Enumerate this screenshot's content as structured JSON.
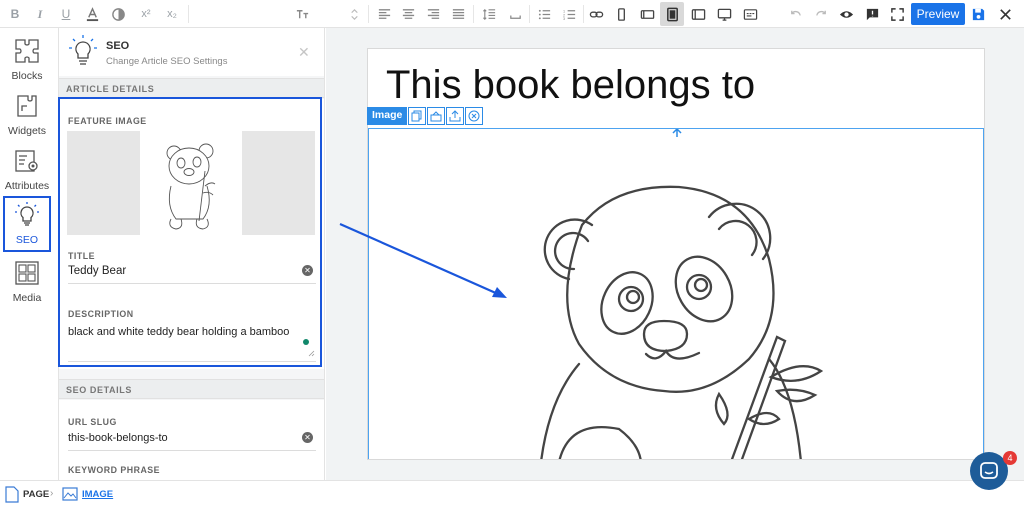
{
  "toolbar": {
    "buttons": [
      "bold-icon",
      "italic-icon",
      "underline-icon",
      "text-color-icon",
      "contrast-icon",
      "superscript-icon",
      "subscript-icon",
      "font-size-icon",
      "align-left-icon",
      "align-center-icon",
      "align-right-icon",
      "justify-icon",
      "line-height-icon",
      "space-icon",
      "list-icon",
      "numbered-list-icon",
      "link-icon",
      "mobile-icon",
      "tablet-landscape-icon",
      "tablet-icon",
      "tablet-wide-icon",
      "desktop-icon",
      "embed-icon",
      "undo-icon",
      "redo-icon",
      "eye-icon",
      "comment-icon",
      "fullscreen-icon",
      "save-icon"
    ],
    "superscript_label": "x²",
    "subscript_label": "x₂",
    "bold_label": "B",
    "italic_label": "I",
    "underline_label": "U",
    "preview_label": "Preview"
  },
  "rail": {
    "items": [
      {
        "label": "Blocks",
        "icon": "puzzle-icon"
      },
      {
        "label": "Widgets",
        "icon": "widget-icon"
      },
      {
        "label": "Attributes",
        "icon": "attributes-gear-icon"
      },
      {
        "label": "SEO",
        "icon": "lightbulb-icon",
        "active": true
      },
      {
        "label": "Media",
        "icon": "media-icon"
      }
    ]
  },
  "panel": {
    "title": "SEO",
    "subtitle": "Change Article SEO Settings",
    "article_details_header": "ARTICLE DETAILS",
    "feature_image_label": "FEATURE IMAGE",
    "title_label": "TITLE",
    "title_value": "Teddy Bear",
    "description_label": "DESCRIPTION",
    "description_value": "black and white teddy bear holding a bamboo",
    "seo_details_header": "SEO DETAILS",
    "url_slug_label": "URL SLUG",
    "url_slug_value": "this-book-belongs-to",
    "keyword_label": "KEYWORD PHRASE"
  },
  "canvas": {
    "heading": "This book belongs to",
    "image_tag": "Image"
  },
  "breadcrumb": {
    "page": "PAGE",
    "image": "IMAGE"
  },
  "chat": {
    "badge": "4"
  },
  "colors": {
    "accent": "#1a73e8",
    "highlight": "#1a56db"
  }
}
